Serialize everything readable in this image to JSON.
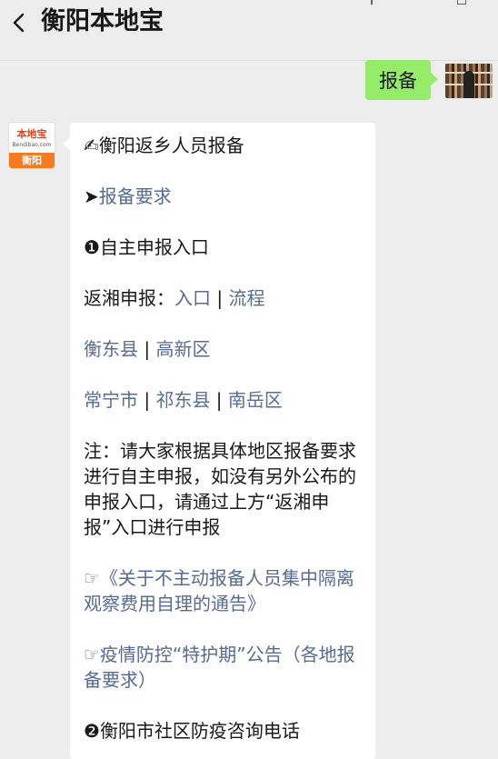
{
  "header": {
    "title": "衡阳本地宝"
  },
  "sent_message": {
    "text": "报备"
  },
  "bot_avatar": {
    "brand": "本地宝",
    "site": "Bendibao.com",
    "city": "衡阳"
  },
  "article": {
    "heading": "衡阳返乡人员报备",
    "heading_icon": "✍",
    "section1": {
      "arrow": "➤",
      "label": "报备要求"
    },
    "item1": {
      "bullet": "❶",
      "label": "自主申报入口"
    },
    "return_line": {
      "prefix": "返湘申报：",
      "link1": "入口",
      "sep": " | ",
      "link2": "流程"
    },
    "district_row1": {
      "a": "衡东县",
      "sep": " | ",
      "b": "高新区"
    },
    "district_row2": {
      "a": "常宁市",
      "sep1": " | ",
      "b": "祁东县",
      "sep2": " | ",
      "c": "南岳区"
    },
    "note": "注：请大家根据具体地区报备要求进行自主申报，如没有另外公布的申报入口，请通过上方“返湘申报”入口进行申报",
    "notice_link": "☞《关于不主动报备人员集中隔离观察费用自理的通告》",
    "period_link": "☞疫情防控“特护期”公告（各地报备要求）",
    "item2": {
      "bullet": "❷",
      "label": "衡阳市社区防疫咨询电话"
    }
  }
}
